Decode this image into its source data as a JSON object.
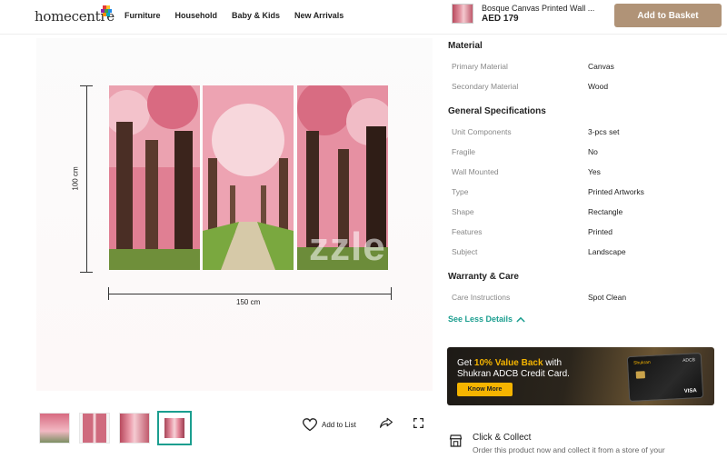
{
  "header": {
    "logo_text": "homecentre",
    "nav": [
      "Furniture",
      "Household",
      "Baby & Kids",
      "New Arrivals"
    ],
    "product_title": "Bosque Canvas Printed Wall ...",
    "price": "AED 179",
    "add_to_basket": "Add to Basket"
  },
  "gallery": {
    "height_label": "100 cm",
    "width_label": "150 cm",
    "watermark": "zzle",
    "add_to_list": "Add to List"
  },
  "specs": {
    "material_title": "Material",
    "material": [
      {
        "k": "Primary Material",
        "v": "Canvas"
      },
      {
        "k": "Secondary Material",
        "v": "Wood"
      }
    ],
    "general_title": "General Specifications",
    "general": [
      {
        "k": "Unit Components",
        "v": "3-pcs set"
      },
      {
        "k": "Fragile",
        "v": "No"
      },
      {
        "k": "Wall Mounted",
        "v": "Yes"
      },
      {
        "k": "Type",
        "v": "Printed Artworks"
      },
      {
        "k": "Shape",
        "v": "Rectangle"
      },
      {
        "k": "Features",
        "v": "Printed"
      },
      {
        "k": "Subject",
        "v": "Landscape"
      }
    ],
    "warranty_title": "Warranty & Care",
    "warranty": [
      {
        "k": "Care Instructions",
        "v": "Spot Clean"
      }
    ],
    "see_less": "See Less Details"
  },
  "banner": {
    "line1_pre": "Get ",
    "line1_highlight": "10% Value Back",
    "line1_post": " with",
    "line2": "Shukran ADCB Credit Card.",
    "button": "Know More",
    "card_brand": "Shukran",
    "card_bank": "ADCB",
    "card_network": "VISA"
  },
  "click_collect": {
    "title": "Click & Collect",
    "subtitle": "Order this product now and collect it from a store of your"
  },
  "colors": {
    "accent": "#1b9e8f",
    "basket_button": "#b09377",
    "banner_highlight": "#f5b400"
  }
}
